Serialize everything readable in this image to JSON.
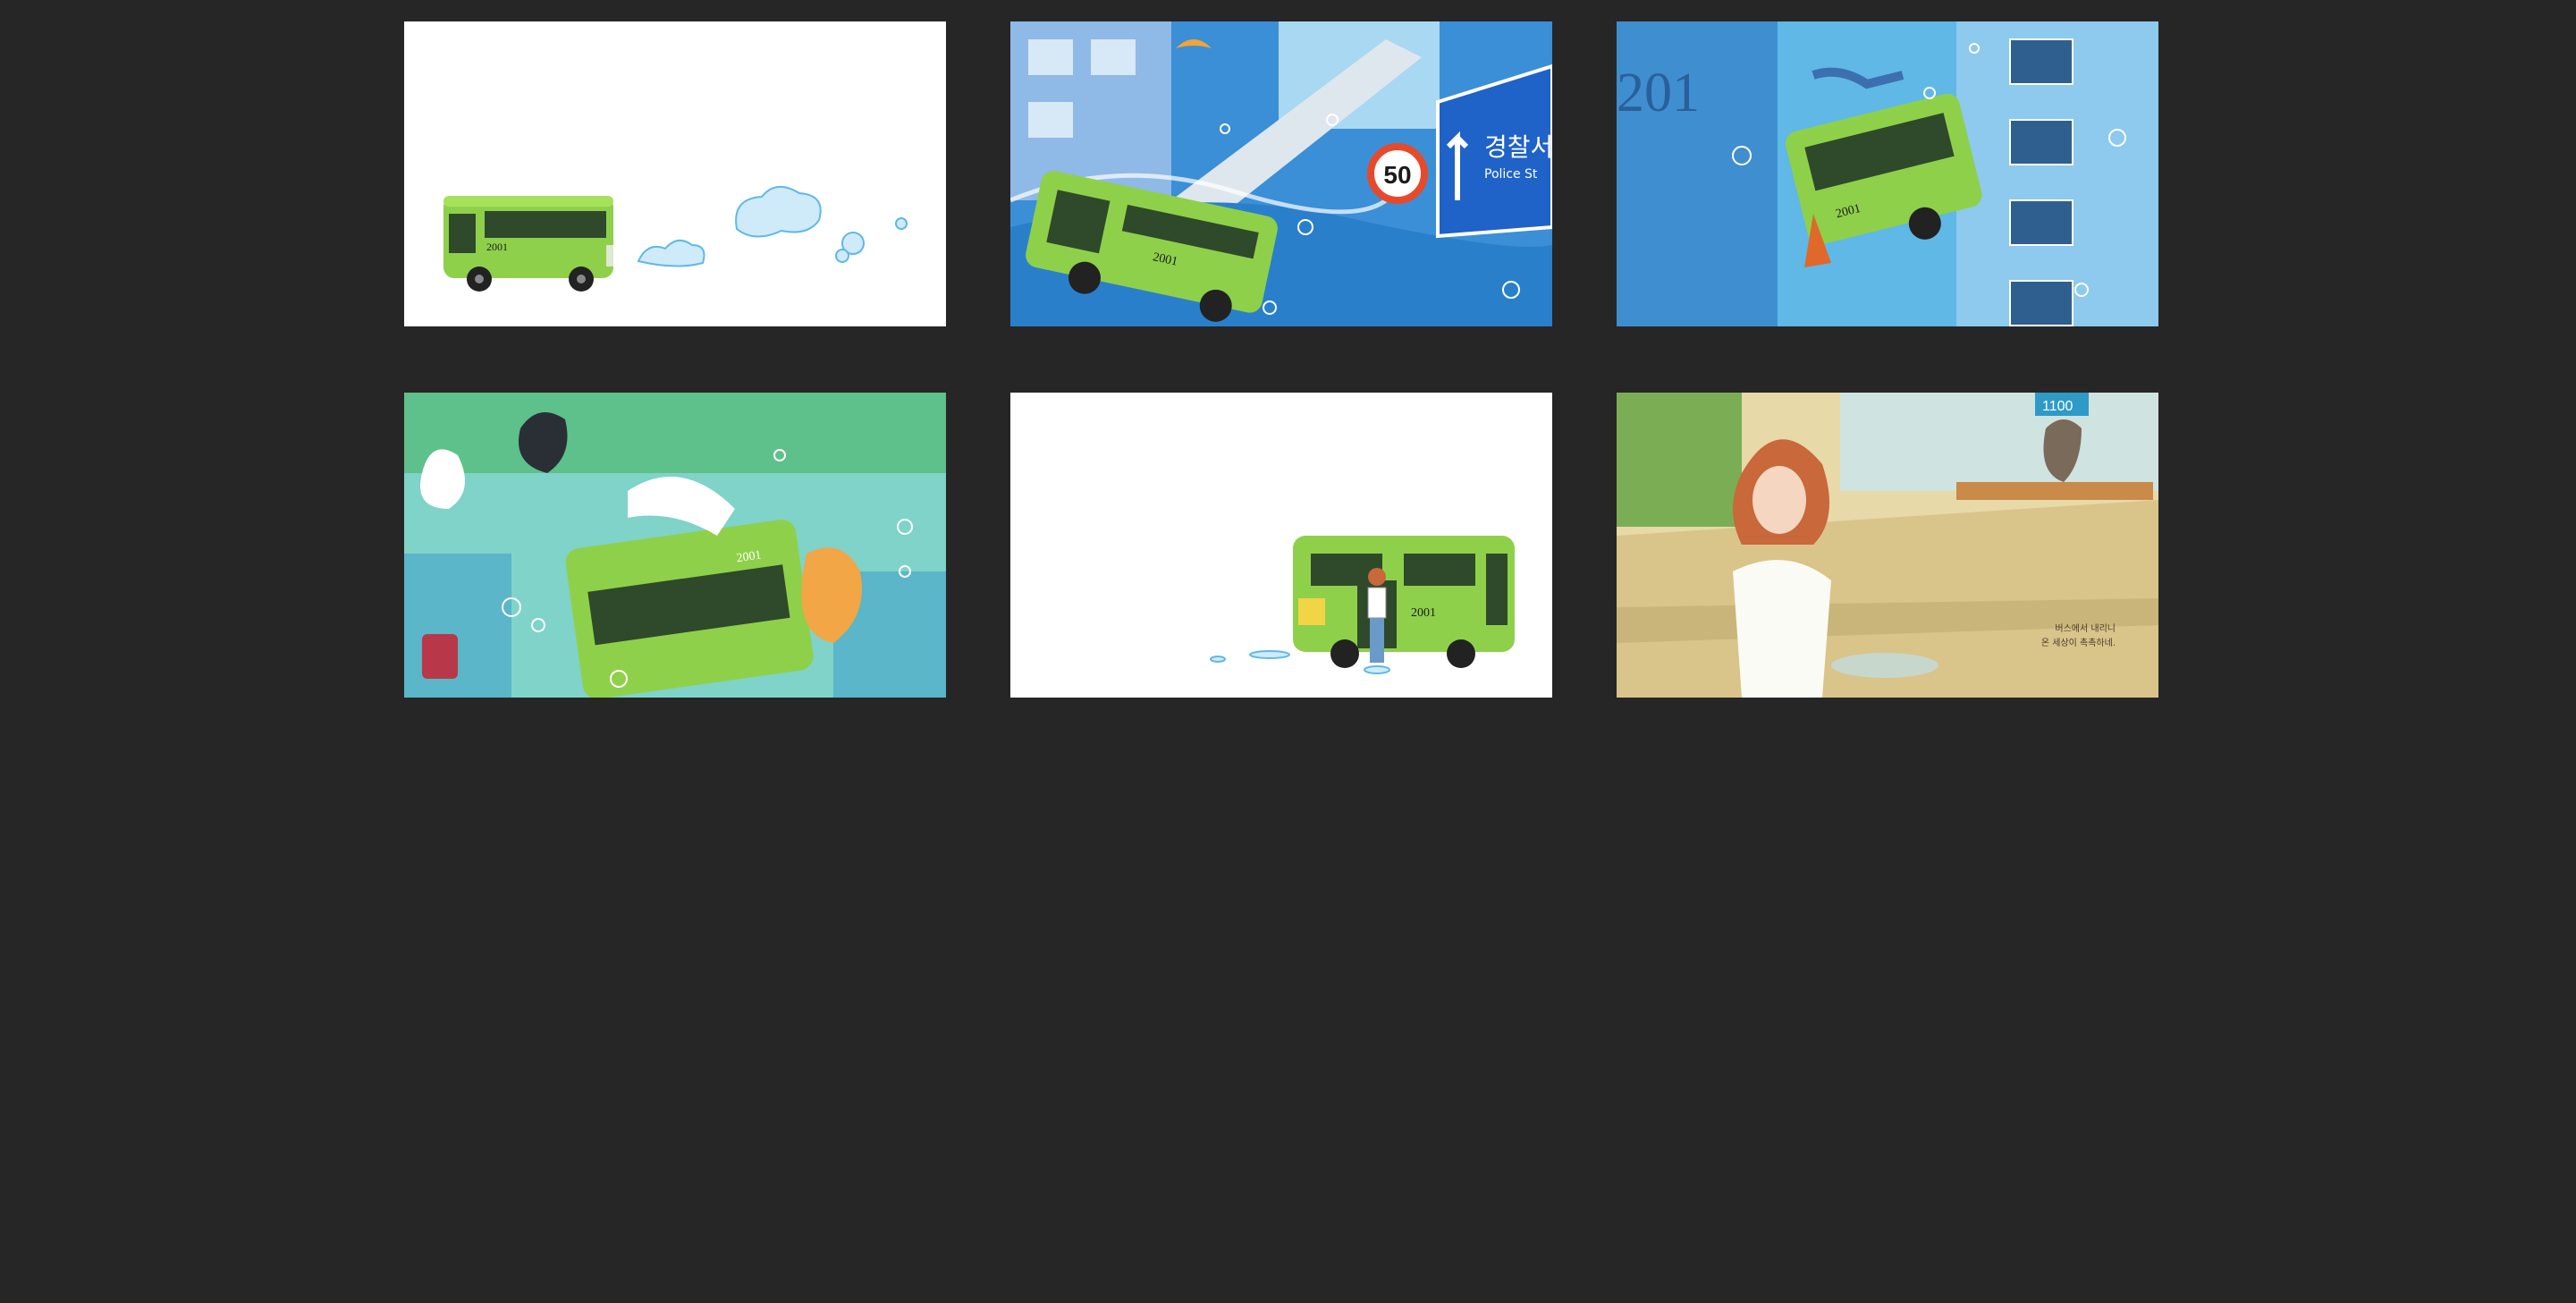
{
  "gallery": {
    "tiles": [
      {
        "id": "bus-leaving-bubbles",
        "bus_number": "2001",
        "background": "#ffffff"
      },
      {
        "id": "bus-flooded-city",
        "bus_number": "2001",
        "speed_sign": "50",
        "road_sign_korean": "경찰서",
        "road_sign_english": "Police St",
        "background": "#3b8fd6"
      },
      {
        "id": "bus-floating-apartments",
        "bus_number": "2001",
        "building_number": "201",
        "background": "#5fb8e6"
      },
      {
        "id": "bus-with-cats-and-boy",
        "bus_number": "2001",
        "background": "#7fd3c9"
      },
      {
        "id": "bus-girl-stepping-out",
        "bus_number": "2001",
        "background": "#ffffff"
      },
      {
        "id": "girl-at-bus-stop",
        "stop_number": "1100",
        "caption_line1": "버스에서 내리니",
        "caption_line2": "온 세상이 촉촉하네.",
        "background": "#e8d9a8"
      }
    ]
  },
  "colors": {
    "page_background": "#262626",
    "bus_green": "#8fd04a",
    "bus_dark": "#2f4a2a",
    "water_blue": "#4aa3e0"
  }
}
